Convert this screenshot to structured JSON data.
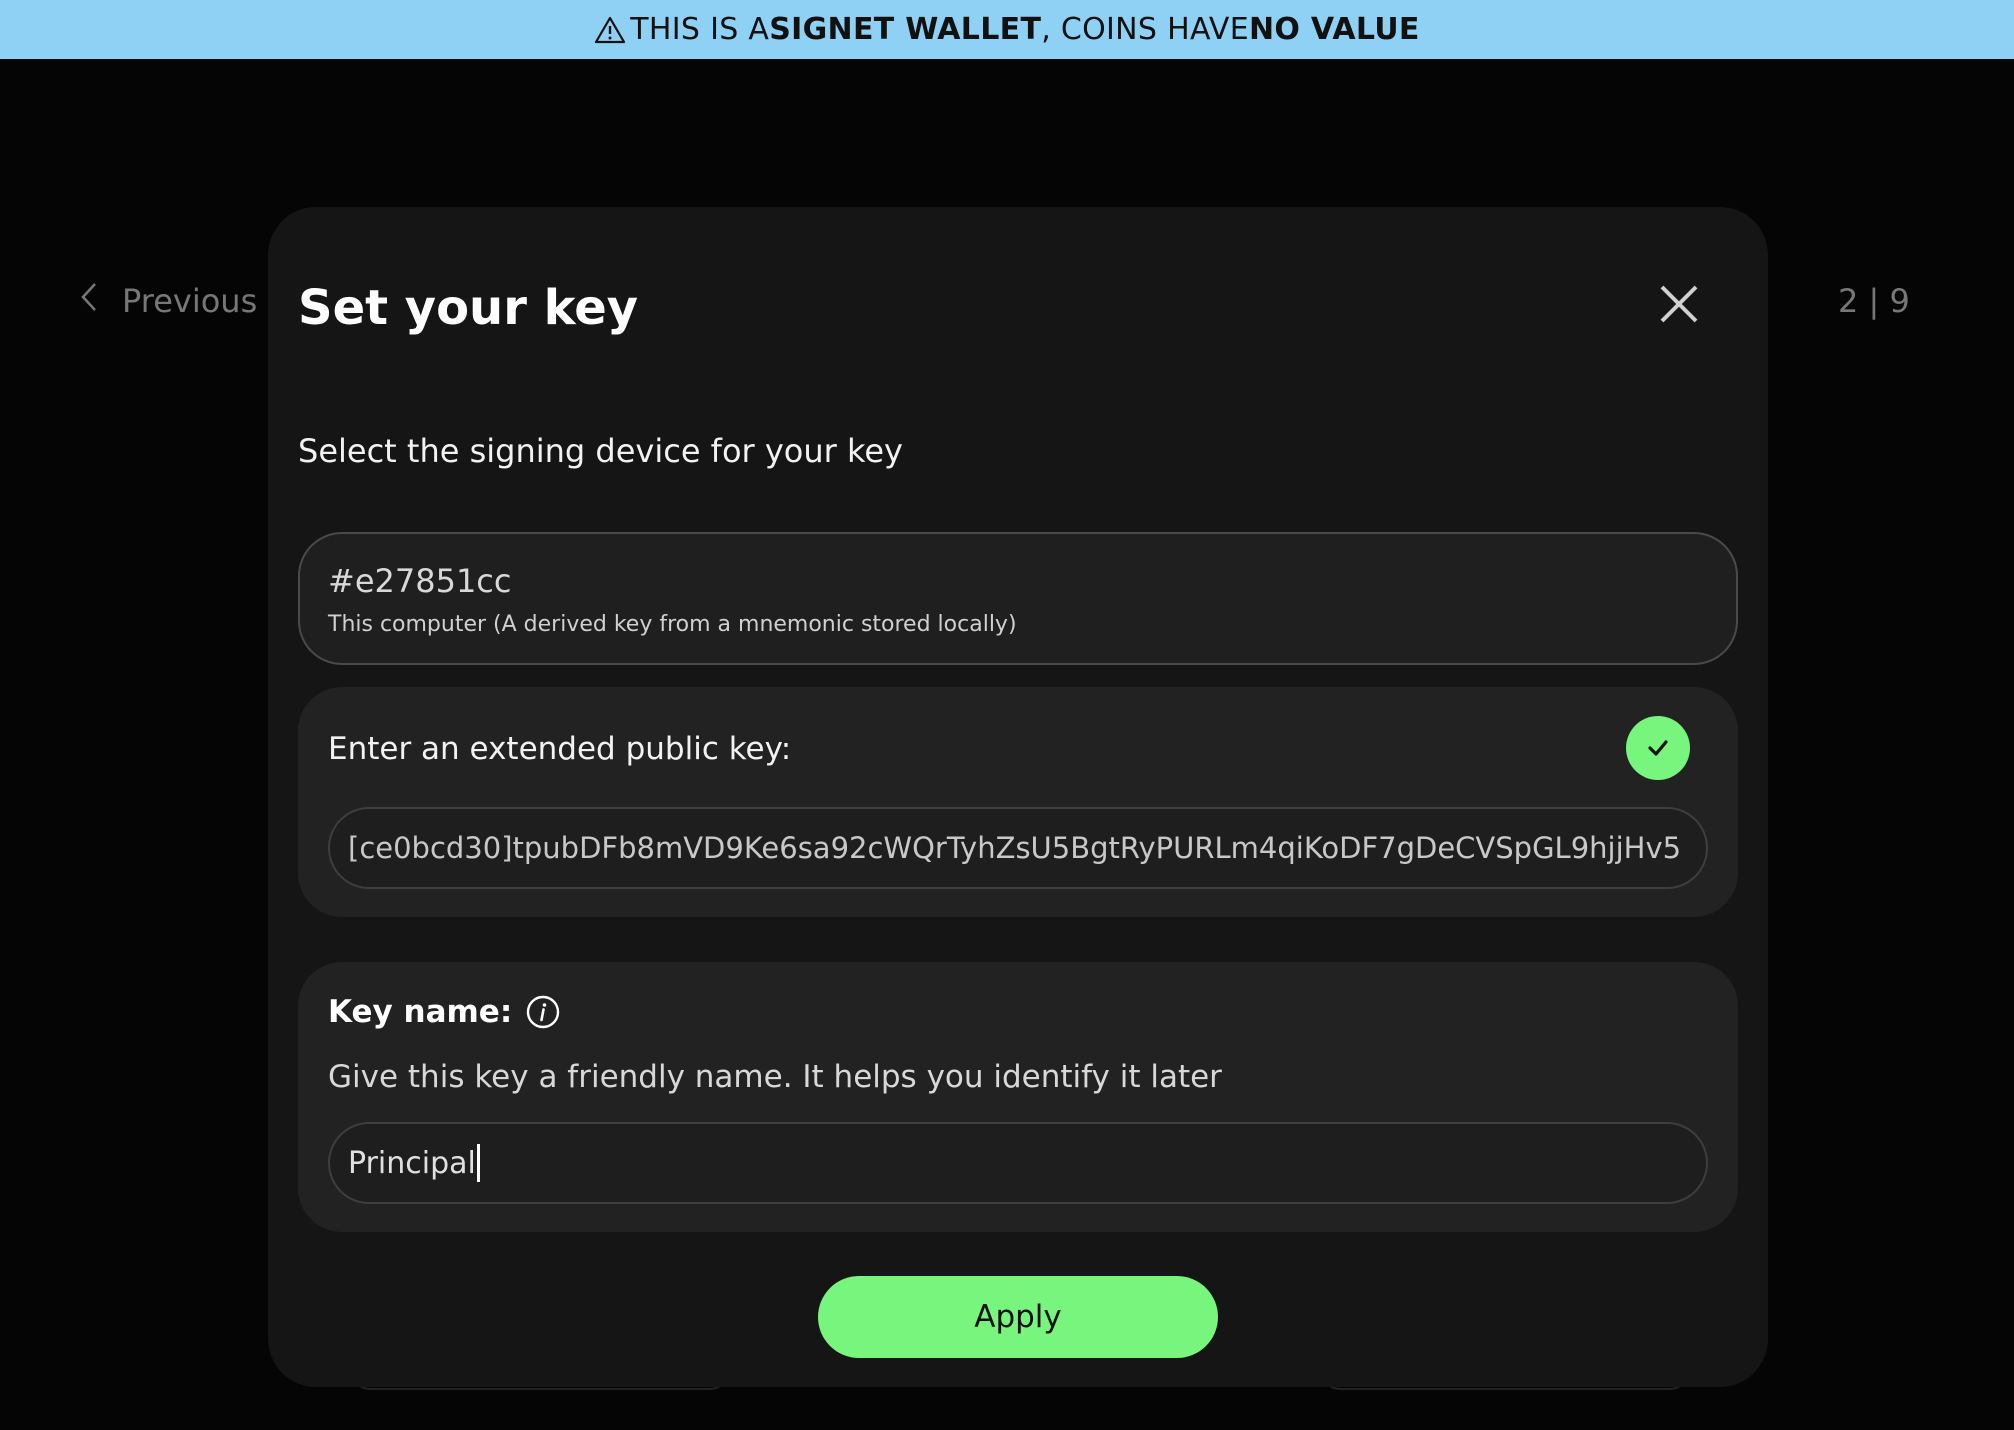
{
  "banner": {
    "prefix": "THIS IS A ",
    "emphasis1": "SIGNET WALLET",
    "middle": ", COINS HAVE ",
    "emphasis2": "NO VALUE",
    "icon": "warning-triangle-icon",
    "background": "#8fd0f5"
  },
  "background_nav": {
    "previous_label": "Previous",
    "step_indicator": "2 | 9"
  },
  "modal": {
    "title": "Set your key",
    "subtitle": "Select the signing device for your key",
    "device": {
      "fingerprint": "#e27851cc",
      "description": "This computer  (A derived key from a mnemonic stored locally)"
    },
    "xpub": {
      "label": "Enter an extended public key:",
      "value": "[ce0bcd30]tpubDFb8mVD9Ke6sa92cWQrTyhZsU5BgtRyPURLm4qiKoDF7gDeCVSpGL9hjjHv5",
      "valid": true
    },
    "key_name": {
      "label": "Key name:",
      "help": "Give this key a friendly name. It helps you identify it later",
      "value": "Principal"
    },
    "apply_label": "Apply"
  },
  "colors": {
    "accent": "#78f57c",
    "modal_bg": "#151515",
    "card_bg": "#222222",
    "page_bg": "#050505"
  }
}
